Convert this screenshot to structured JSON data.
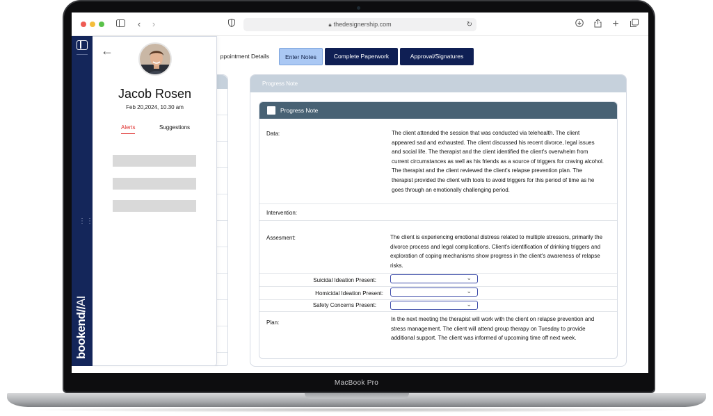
{
  "device": {
    "bezel_label": "MacBook Pro"
  },
  "browser": {
    "url": "thedesignership.com",
    "icons": [
      "sidebar-icon",
      "back-icon",
      "forward-icon",
      "shield-icon",
      "lock-icon",
      "reload-icon",
      "download-icon",
      "share-icon",
      "new-tab-icon",
      "tabs-icon"
    ]
  },
  "brand": {
    "name": "bookend",
    "suffix": "AI"
  },
  "profile": {
    "name": "Jacob Rosen",
    "date": "Feb 20,2024, 10.30 am",
    "tabs": {
      "alerts": "Alerts",
      "suggestions": "Suggestions"
    }
  },
  "tabs": {
    "appointment": "ppointment Details",
    "notes": "Enter Notes",
    "paperwork": "Complete Paperwork",
    "approval": "Approval/Signatures"
  },
  "progress": {
    "card_title": "Progress Note",
    "inner_title": "Progress Note",
    "data_label": "Data:",
    "data_text": "The client attended the session that was conducted via telehealth. The client appeared sad and exhausted. The client discussed his recent divorce, legal issues and social life. The therapist and the client identified the client's overwhelm from current circumstances as well as his friends as a source of triggers for craving alcohol. The therapist and the client reviewed the client's relapse prevention plan. The therapist provided the client with tools to avoid triggers for this period of time as he goes through an emotionally challenging period.",
    "intervention_label": "Intervention:",
    "assessment_label": "Assesment:",
    "assessment_text": "The client is experiencing emotional distress related to multiple stressors, primarily the divorce process and legal complications. Client's identification of drinking triggers and exploration of coping mechanisms show progress in the client's awareness of relapse risks.",
    "suicidal_label": "Suicidal Ideation Present:",
    "homicidal_label": "Homicidal Ideation Present:",
    "safety_label": "Safety Concerns Present:",
    "plan_label": "Plan:",
    "plan_text": "In the next meeting the therapist will work with the client on relapse prevention and stress management. The client will attend group therapy on Tuesday to provide additional support. The client was informed of upcoming time off next week."
  },
  "colors": {
    "navy": "#0f1f54",
    "active_tab": "#aac8f4",
    "card_header": "#c6d1dc",
    "inner_header": "#486274",
    "alert": "#e0312f"
  }
}
